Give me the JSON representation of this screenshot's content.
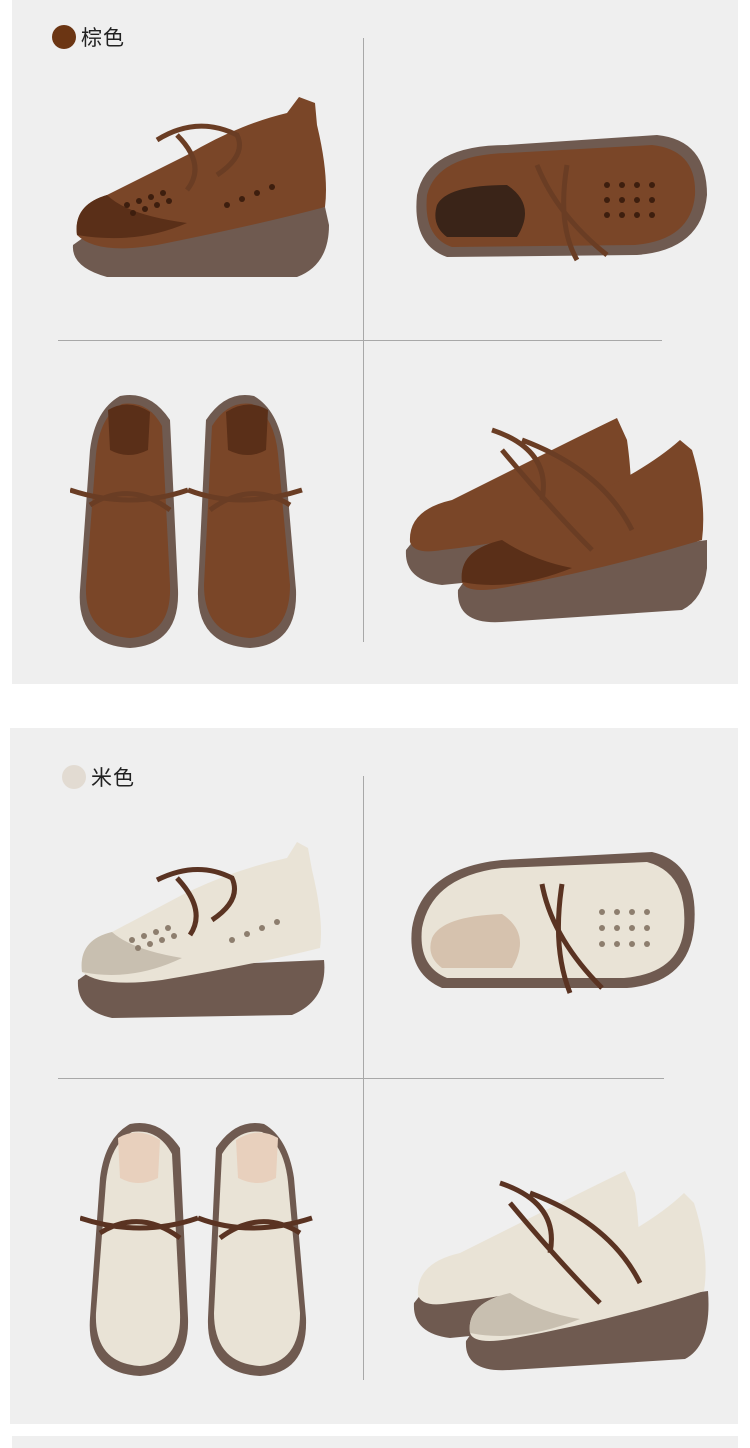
{
  "colors": {
    "brown": {
      "label": "棕色",
      "swatch": "#6b3513",
      "upper": "#7a4628",
      "upper_dark": "#5a2f18",
      "sole": "#6f5a50",
      "lace": "#6a3d24"
    },
    "beige": {
      "label": "米色",
      "swatch": "#e2dbd2",
      "upper": "#e9e3d6",
      "upper_dark": "#c8bfb0",
      "sole": "#6f5a50",
      "lace": "#5a3322"
    }
  },
  "panels": [
    {
      "id": "brown",
      "views": [
        "side",
        "top-tilted",
        "front-pair",
        "angled-pair"
      ]
    },
    {
      "id": "beige",
      "views": [
        "side",
        "top-tilted",
        "front-pair",
        "angled-pair"
      ]
    }
  ]
}
